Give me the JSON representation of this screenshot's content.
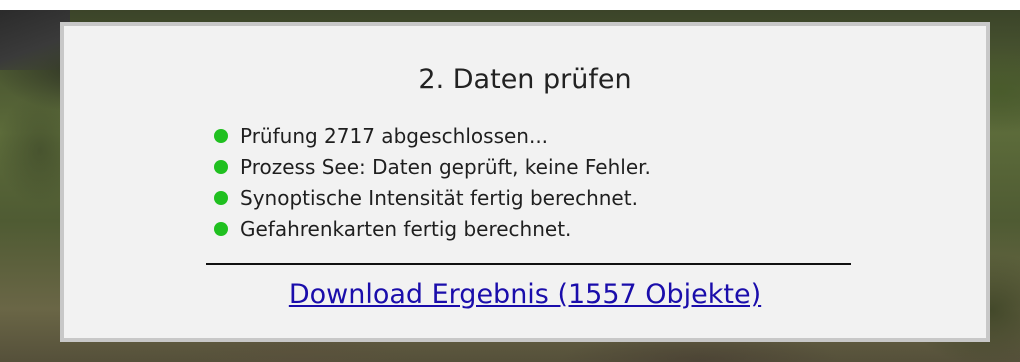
{
  "dialog": {
    "title": "2. Daten prüfen",
    "status_items": [
      {
        "text": "Prüfung 2717 abgeschlossen...",
        "status": "success"
      },
      {
        "text": "Prozess See: Daten geprüft, keine Fehler.",
        "status": "success"
      },
      {
        "text": "Synoptische Intensität fertig berechnet.",
        "status": "success"
      },
      {
        "text": "Gefahrenkarten fertig berechnet.",
        "status": "success"
      }
    ],
    "download_link_text": "Download Ergebnis (1557 Objekte)"
  },
  "colors": {
    "status_dot": "#20c020",
    "link": "#1a0dab",
    "dialog_background": "#f2f2f2",
    "dialog_border": "#c8c8c8"
  }
}
